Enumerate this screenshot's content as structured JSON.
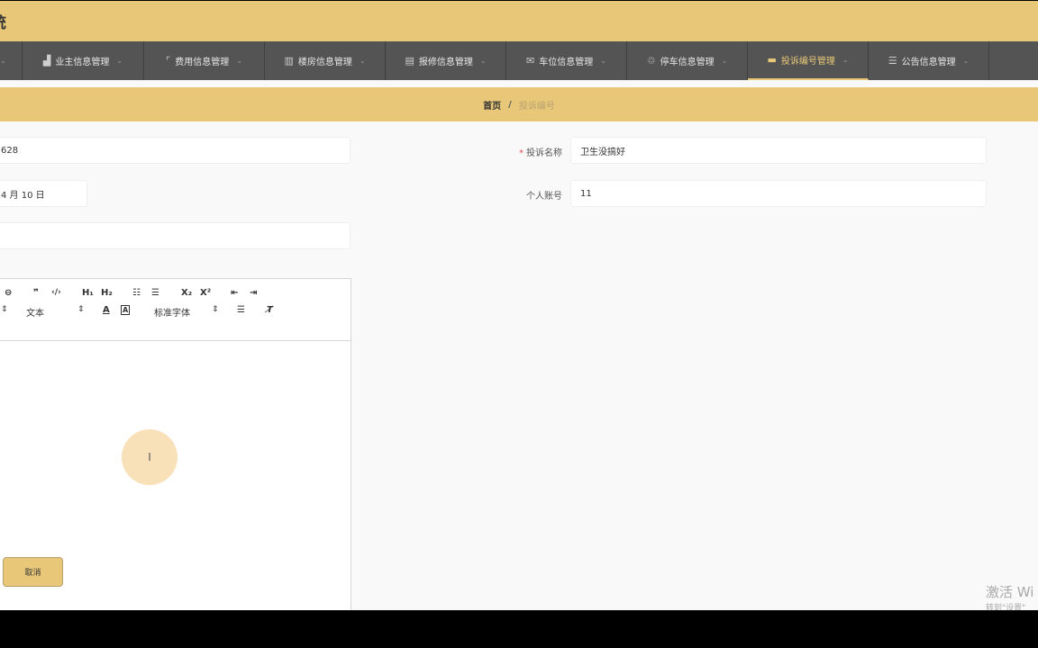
{
  "header": {
    "title": "统"
  },
  "nav": {
    "items": [
      {
        "label": "业主信息管理",
        "icon": "chart-icon"
      },
      {
        "label": "费用信息管理",
        "icon": "crop-icon"
      },
      {
        "label": "楼房信息管理",
        "icon": "bar-chart-icon"
      },
      {
        "label": "报修信息管理",
        "icon": "list-icon"
      },
      {
        "label": "车位信息管理",
        "icon": "mail-icon"
      },
      {
        "label": "停车信息管理",
        "icon": "recycle-icon"
      },
      {
        "label": "投诉编号管理",
        "icon": "briefcase-icon",
        "active": true
      },
      {
        "label": "公告信息管理",
        "icon": "sliders-icon"
      }
    ],
    "chevron": "⌄"
  },
  "breadcrumb": {
    "home": "首页",
    "separator": "/",
    "current": "投诉编号"
  },
  "form": {
    "complaint_number": {
      "value": "628"
    },
    "complaint_name": {
      "label": "投诉名称",
      "required_mark": "*",
      "value": "卫生没搞好"
    },
    "date": {
      "value": "4 月 10 日"
    },
    "account": {
      "label": "个人账号",
      "value": "11"
    },
    "third_input": {
      "value": ""
    }
  },
  "editor": {
    "toolbar_row1": [
      "⊖",
      "❞",
      "‹/›",
      "H₁",
      "H₂",
      "☷",
      "☰",
      "X₂",
      "X²",
      "⇤",
      "⇥"
    ],
    "size_select": "⇕",
    "text_select": "文本",
    "font_select": "标准字体",
    "align_glyph": "☰",
    "clear_glyph": "T̸"
  },
  "cancel_button": {
    "label": "取消"
  },
  "cursor": {
    "glyph": "I"
  },
  "watermark": {
    "line1": "激活 Wi",
    "line2": "转到\"设置\""
  },
  "colors": {
    "accent": "#e8c878",
    "nav_bg": "#545454",
    "page_bg": "#f9f9f9"
  }
}
